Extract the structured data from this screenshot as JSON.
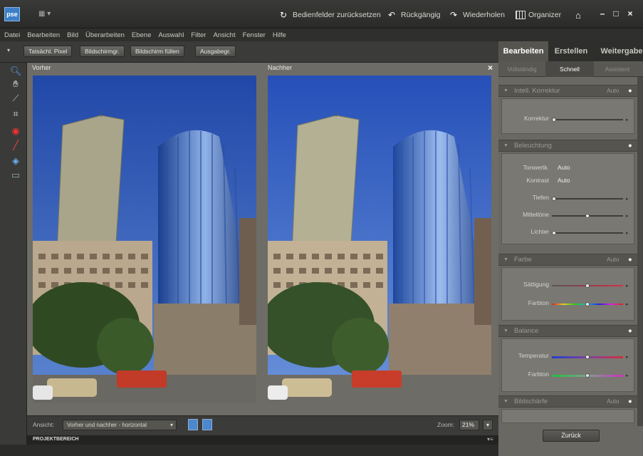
{
  "app": {
    "logo": "pse",
    "layout_icon": "layout-menu"
  },
  "titlebar": {
    "reset_panels": "Bedienfelder zurücksetzen",
    "undo": "Rückgängig",
    "redo": "Wiederholen",
    "organizer": "Organizer",
    "win_min": "–",
    "win_max": "□",
    "win_close": "×"
  },
  "menu": [
    "Datei",
    "Bearbeiten",
    "Bild",
    "Überarbeiten",
    "Ebene",
    "Auswahl",
    "Filter",
    "Ansicht",
    "Fenster",
    "Hilfe"
  ],
  "view_buttons": [
    "Tatsächl. Pixel",
    "Bildschirmgr.",
    "Bildschirm füllen",
    "Ausgabegr."
  ],
  "panes": {
    "before": "Vorher",
    "after": "Nachher",
    "close": "×"
  },
  "bottom": {
    "view_label": "Ansicht:",
    "view_value": "Vorher und nachher - horizontal",
    "zoom_label": "Zoom:",
    "zoom_value": "21%",
    "project": "PROJEKTBEREICH"
  },
  "right_tabs": [
    "Bearbeiten",
    "Erstellen",
    "Weitergabe"
  ],
  "sub_tabs": [
    "Vollständig",
    "Schnell",
    "Assistent"
  ],
  "sections": {
    "smartfix": {
      "title": "Intell. Korrektur",
      "auto": "Auto",
      "label": "Korrektur",
      "level": 0.0
    },
    "lighting": {
      "title": "Beleuchtung",
      "levels": "Tonwertk.",
      "levels_auto": "Auto",
      "contrast": "Kontrast",
      "contrast_auto": "Auto",
      "shadows": "Tiefen",
      "shadows_level": 0.0,
      "midtones": "Mitteltöne",
      "midtones_level": 0.5,
      "highlights": "Lichter",
      "highlights_level": 0.0
    },
    "color": {
      "title": "Farbe",
      "auto": "Auto",
      "saturation": "Sättigung",
      "saturation_level": 0.5,
      "hue": "Farbton",
      "hue_level": 0.5
    },
    "balance": {
      "title": "Balance",
      "temperature": "Temperatur",
      "temperature_level": 0.5,
      "tint": "Farbton",
      "tint_level": 0.5
    },
    "sharpness": {
      "title": "Bildschärfe",
      "auto": "Auto"
    }
  },
  "reset_button": "Zurück",
  "colors": {
    "accent": "#3c7fc8",
    "sky": "#3660b8"
  }
}
